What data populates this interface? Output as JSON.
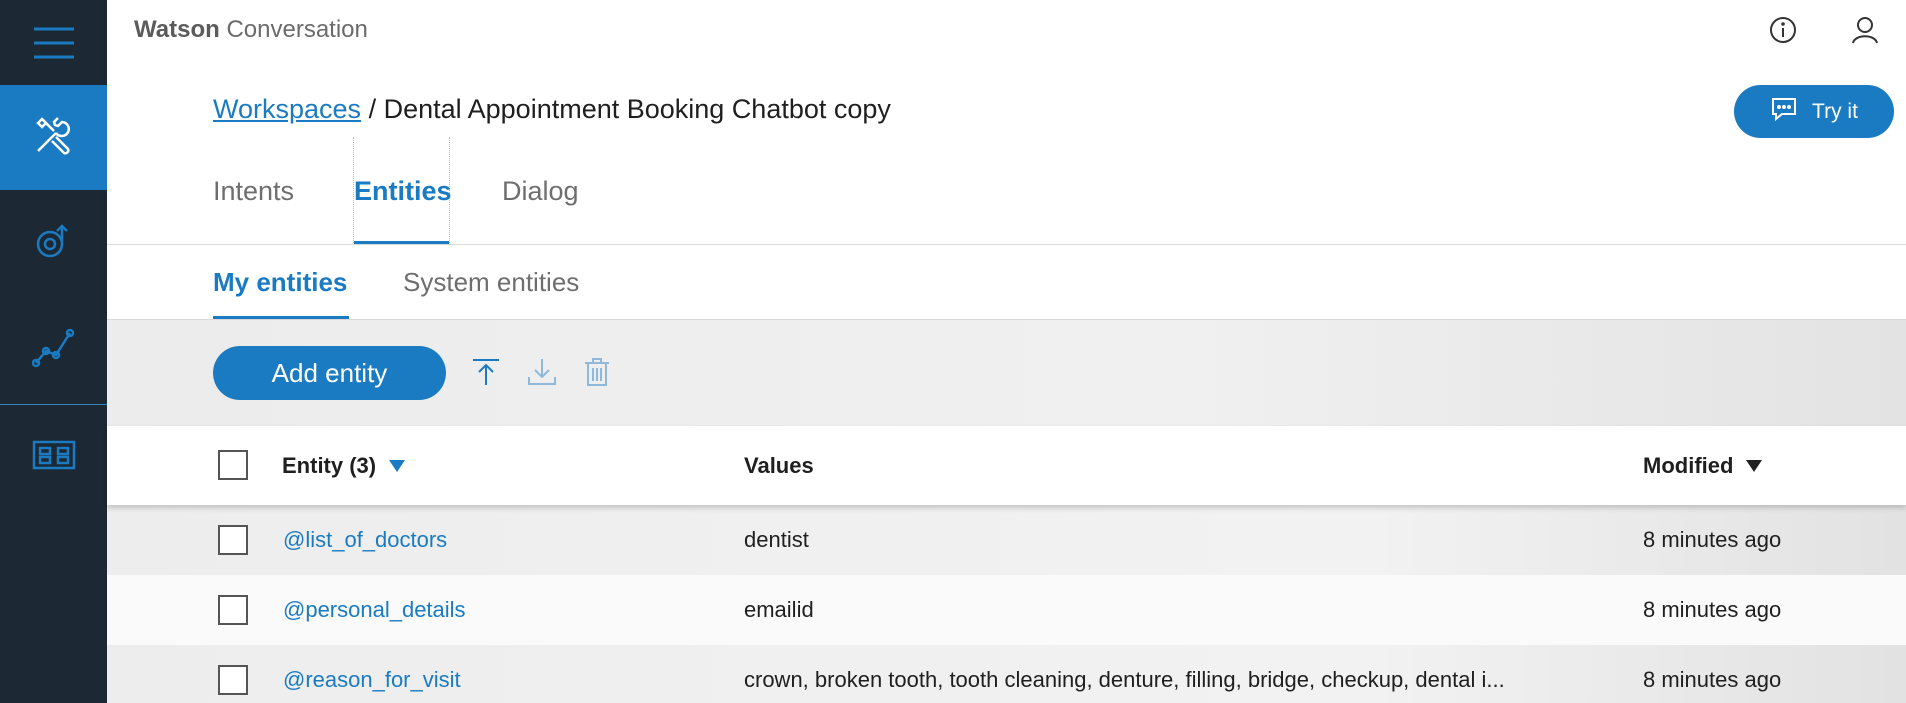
{
  "app": {
    "title_bold": "Watson",
    "title_rest": " Conversation"
  },
  "icons": {
    "menu": "hamburger-menu-icon",
    "tools": "wrench-screwdriver-icon",
    "deploy": "deploy-icon",
    "analytics": "line-chart-icon",
    "workspace": "workspace-grid-icon",
    "info": "info-icon",
    "user": "user-icon",
    "chat": "chat-bubble-icon",
    "upload": "upload-icon",
    "download": "download-icon",
    "trash": "trash-icon"
  },
  "colors": {
    "accent": "#1a7bc2",
    "rail": "#1c2833"
  },
  "breadcrumb": {
    "link": "Workspaces",
    "separator": " / ",
    "current": "Dental Appointment Booking Chatbot copy"
  },
  "try_button": {
    "label": "Try it"
  },
  "tabs": [
    {
      "label": "Intents"
    },
    {
      "label": "Entities"
    },
    {
      "label": "Dialog"
    }
  ],
  "subtabs": [
    {
      "label": "My entities"
    },
    {
      "label": "System entities"
    }
  ],
  "toolbar": {
    "add_label": "Add entity"
  },
  "table": {
    "columns": {
      "entity": "Entity (3)",
      "values": "Values",
      "modified": "Modified"
    },
    "rows": [
      {
        "entity": "@list_of_doctors",
        "values": "dentist",
        "modified": "8 minutes ago"
      },
      {
        "entity": "@personal_details",
        "values": "emailid",
        "modified": "8 minutes ago"
      },
      {
        "entity": "@reason_for_visit",
        "values": "crown, broken tooth, tooth cleaning, denture, filling, bridge, checkup, dental i...",
        "modified": "8 minutes ago"
      }
    ]
  }
}
